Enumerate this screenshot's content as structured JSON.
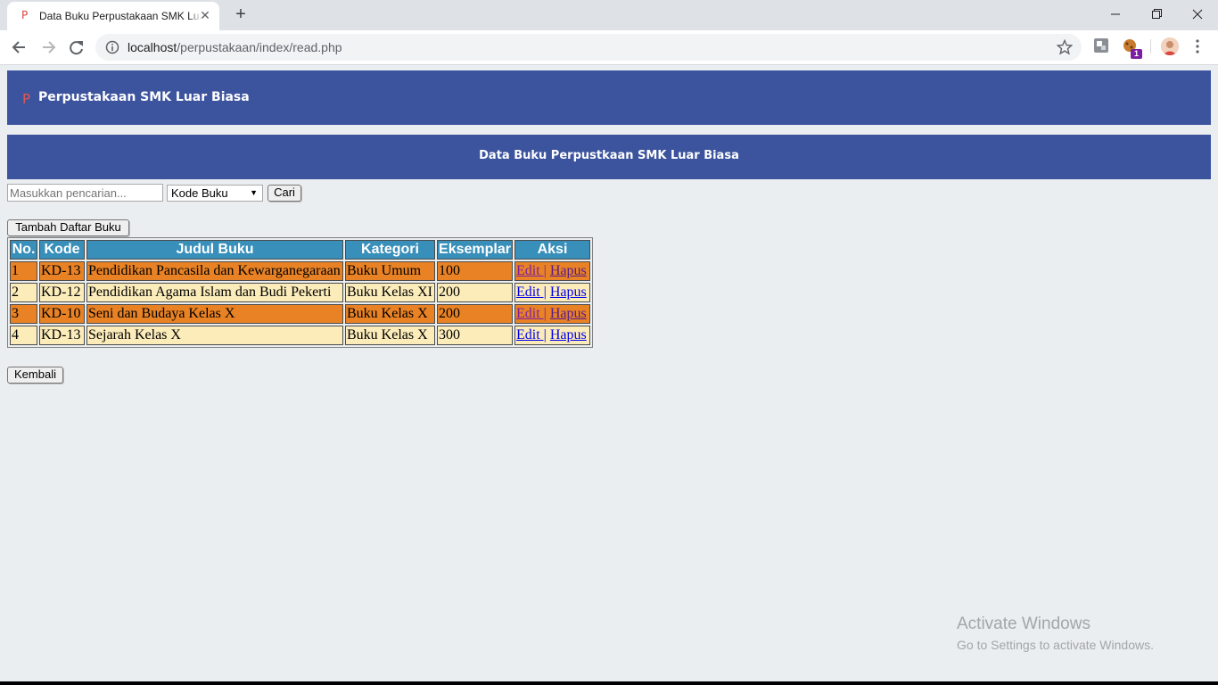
{
  "browser": {
    "tab_favicon": "P",
    "tab_title": "Data Buku Perpustakaan SMK Luar Biasa",
    "url_host": "localhost",
    "url_path": "/perpustakaan/index/read.php",
    "extension_badge": "1"
  },
  "header": {
    "logo_letter": "P",
    "brand_name": "Perpustakaan SMK Luar Biasa"
  },
  "page_title": "Data Buku Perpustkaan SMK Luar Biasa",
  "search": {
    "placeholder": "Masukkan pencarian...",
    "value": "",
    "filter_selected": "Kode Buku",
    "button_label": "Cari"
  },
  "add_button_label": "Tambah Daftar Buku",
  "table": {
    "columns": [
      "No.",
      "Kode",
      "Judul Buku",
      "Kategori",
      "Eksemplar",
      "Aksi"
    ],
    "rows": [
      {
        "no": "1",
        "kode": "KD-13",
        "judul": "Pendidikan Pancasila dan Kewarganegaraan",
        "kategori": "Buku Umum",
        "eksemplar": "100",
        "edit": "Edit |",
        "hapus": "Hapus"
      },
      {
        "no": "2",
        "kode": "KD-12",
        "judul": "Pendidikan Agama Islam dan Budi Pekerti",
        "kategori": "Buku Kelas XI",
        "eksemplar": "200",
        "edit": "Edit |",
        "hapus": "Hapus"
      },
      {
        "no": "3",
        "kode": "KD-10",
        "judul": "Seni dan Budaya Kelas X",
        "kategori": "Buku Kelas X",
        "eksemplar": "200",
        "edit": "Edit |",
        "hapus": "Hapus"
      },
      {
        "no": "4",
        "kode": "KD-13",
        "judul": "Sejarah Kelas X",
        "kategori": "Buku Kelas X",
        "eksemplar": "300",
        "edit": "Edit |",
        "hapus": "Hapus"
      }
    ]
  },
  "back_button_label": "Kembali",
  "watermark": {
    "title": "Activate Windows",
    "subtitle": "Go to Settings to activate Windows."
  },
  "colors": {
    "header_bg": "#3c549d",
    "table_header_bg": "#378fba",
    "row_odd_bg": "#e88225",
    "row_even_bg": "#fbecba"
  }
}
